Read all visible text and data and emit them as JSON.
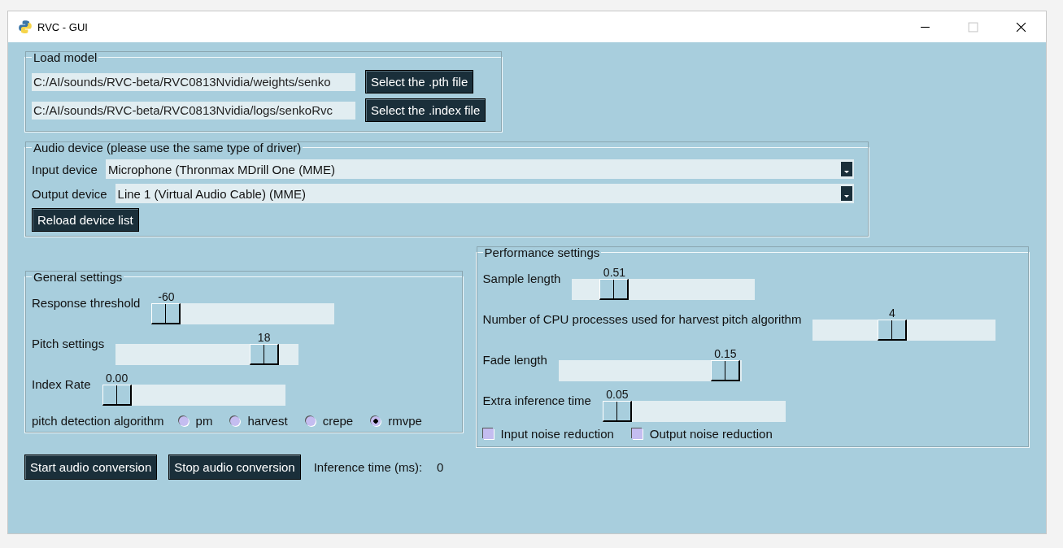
{
  "window": {
    "title": "RVC - GUI"
  },
  "load_model": {
    "title": "Load model",
    "files": [
      {
        "value": "C:/AI/sounds/RVC-beta/RVC0813Nvidia/weights/senko",
        "button": "Select the .pth file"
      },
      {
        "value": "C:/AI/sounds/RVC-beta/RVC0813Nvidia/logs/senkoRvc",
        "button": "Select the .index file"
      }
    ]
  },
  "audio_device": {
    "title": "Audio device (please use the same type of driver)",
    "devices": [
      {
        "label": "Input device",
        "value": "Microphone (Thronmax MDrill One (MME)"
      },
      {
        "label": "Output device",
        "value": "Line 1 (Virtual Audio Cable) (MME)"
      }
    ],
    "reload_button": "Reload device list"
  },
  "general_settings": {
    "title": "General settings",
    "sliders": [
      {
        "label": "Response threshold",
        "reading": "-60",
        "level": 0
      },
      {
        "label": "Pitch settings",
        "reading": "18",
        "level": 0.87
      },
      {
        "label": "Index Rate",
        "reading": "0.00",
        "level": 0
      }
    ],
    "algorithm": {
      "label": "pitch detection algorithm",
      "options": [
        {
          "label": "pm",
          "selected": false
        },
        {
          "label": "harvest",
          "selected": false
        },
        {
          "label": "crepe",
          "selected": false
        },
        {
          "label": "rmvpe",
          "selected": true
        }
      ]
    }
  },
  "performance_settings": {
    "title": "Performance settings",
    "sliders": [
      {
        "label": "Sample length",
        "reading": "0.51",
        "level": 0.18
      },
      {
        "label": "Number of CPU processes used for harvest pitch algorithm",
        "reading": "4",
        "level": 0.42
      },
      {
        "label": "Fade length",
        "reading": "0.15",
        "level": 0.99
      },
      {
        "label": "Extra inference time",
        "reading": "0.05",
        "level": 0
      }
    ],
    "checkboxes": [
      {
        "label": "Input noise reduction",
        "checked": false
      },
      {
        "label": "Output noise reduction",
        "checked": false
      }
    ]
  },
  "controls": {
    "start_button": "Start audio conversion",
    "stop_button": "Stop audio conversion",
    "inference_label": "Inference time (ms):",
    "inference_value": "0"
  }
}
